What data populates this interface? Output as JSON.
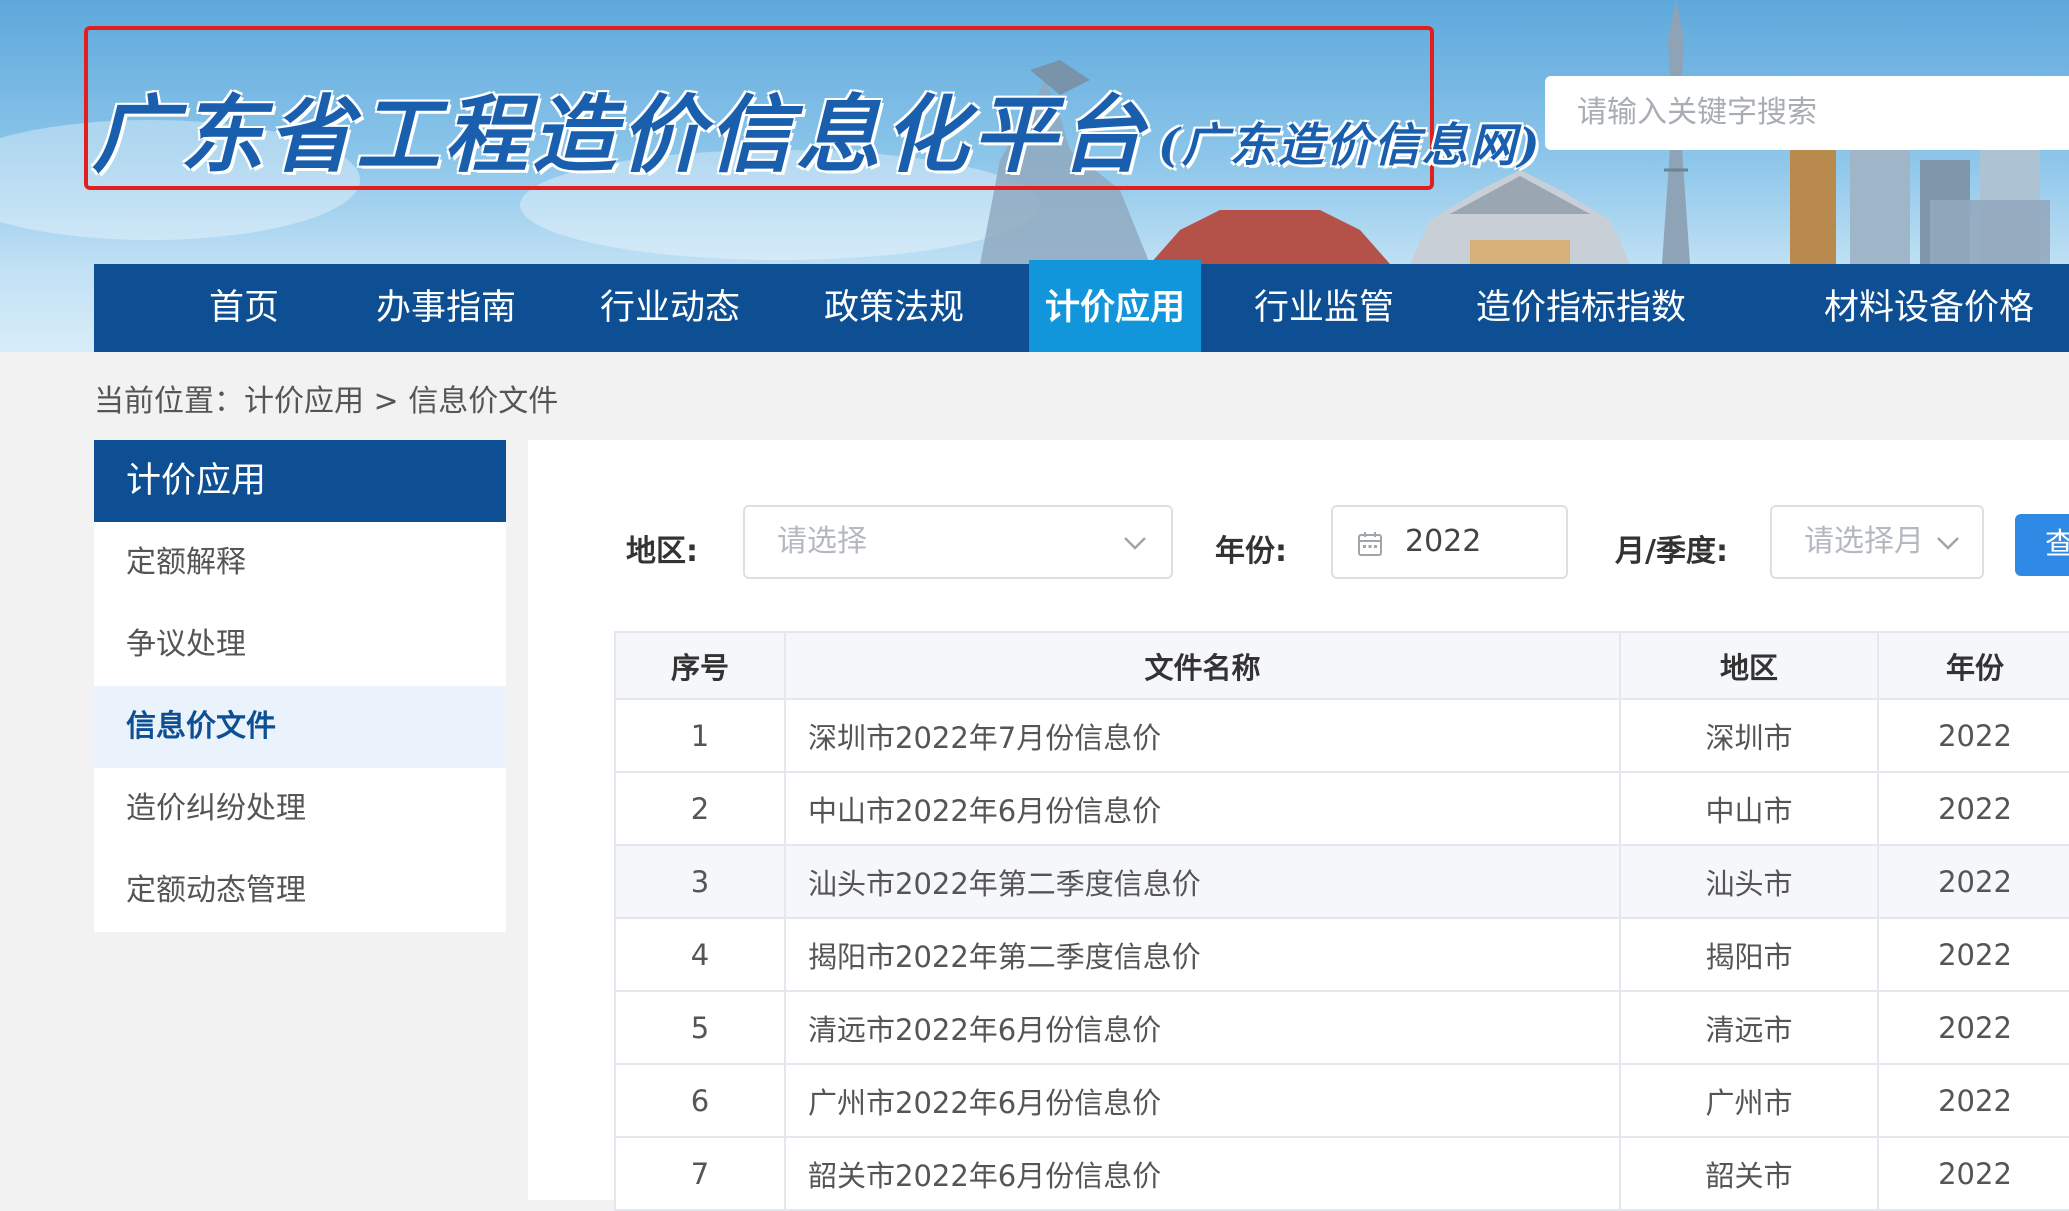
{
  "site": {
    "logo_main": "广东省工程造价信息化平台",
    "logo_sub": "(广东造价信息网)",
    "search_placeholder": "请输入关键字搜索"
  },
  "nav": {
    "items": [
      "首页",
      "办事指南",
      "行业动态",
      "政策法规",
      "计价应用",
      "行业监管",
      "造价指标指数",
      "材料设备价格"
    ],
    "active": "计价应用"
  },
  "breadcrumb": "当前位置：计价应用 > 信息价文件",
  "sidebar": {
    "title": "计价应用",
    "items": [
      "定额解释",
      "争议处理",
      "信息价文件",
      "造价纠纷处理",
      "定额动态管理"
    ],
    "active": "信息价文件"
  },
  "filters": {
    "region_label": "地区:",
    "region_placeholder": "请选择",
    "year_label": "年份:",
    "year_value": "2022",
    "period_label": "月/季度:",
    "period_placeholder": "请选择月",
    "query_button": "查"
  },
  "table": {
    "headers": [
      "序号",
      "文件名称",
      "地区",
      "年份"
    ],
    "rows": [
      [
        "1",
        "深圳市2022年7月份信息价",
        "深圳市",
        "2022"
      ],
      [
        "2",
        "中山市2022年6月份信息价",
        "中山市",
        "2022"
      ],
      [
        "3",
        "汕头市2022年第二季度信息价",
        "汕头市",
        "2022"
      ],
      [
        "4",
        "揭阳市2022年第二季度信息价",
        "揭阳市",
        "2022"
      ],
      [
        "5",
        "清远市2022年6月份信息价",
        "清远市",
        "2022"
      ],
      [
        "6",
        "广州市2022年6月份信息价",
        "广州市",
        "2022"
      ],
      [
        "7",
        "韶关市2022年6月份信息价",
        "韶关市",
        "2022"
      ]
    ]
  },
  "colors": {
    "nav_bg": "#0d4f92",
    "nav_active": "#1296db",
    "logo_border": "#e0201f",
    "query_button": "#2f8ae5"
  }
}
